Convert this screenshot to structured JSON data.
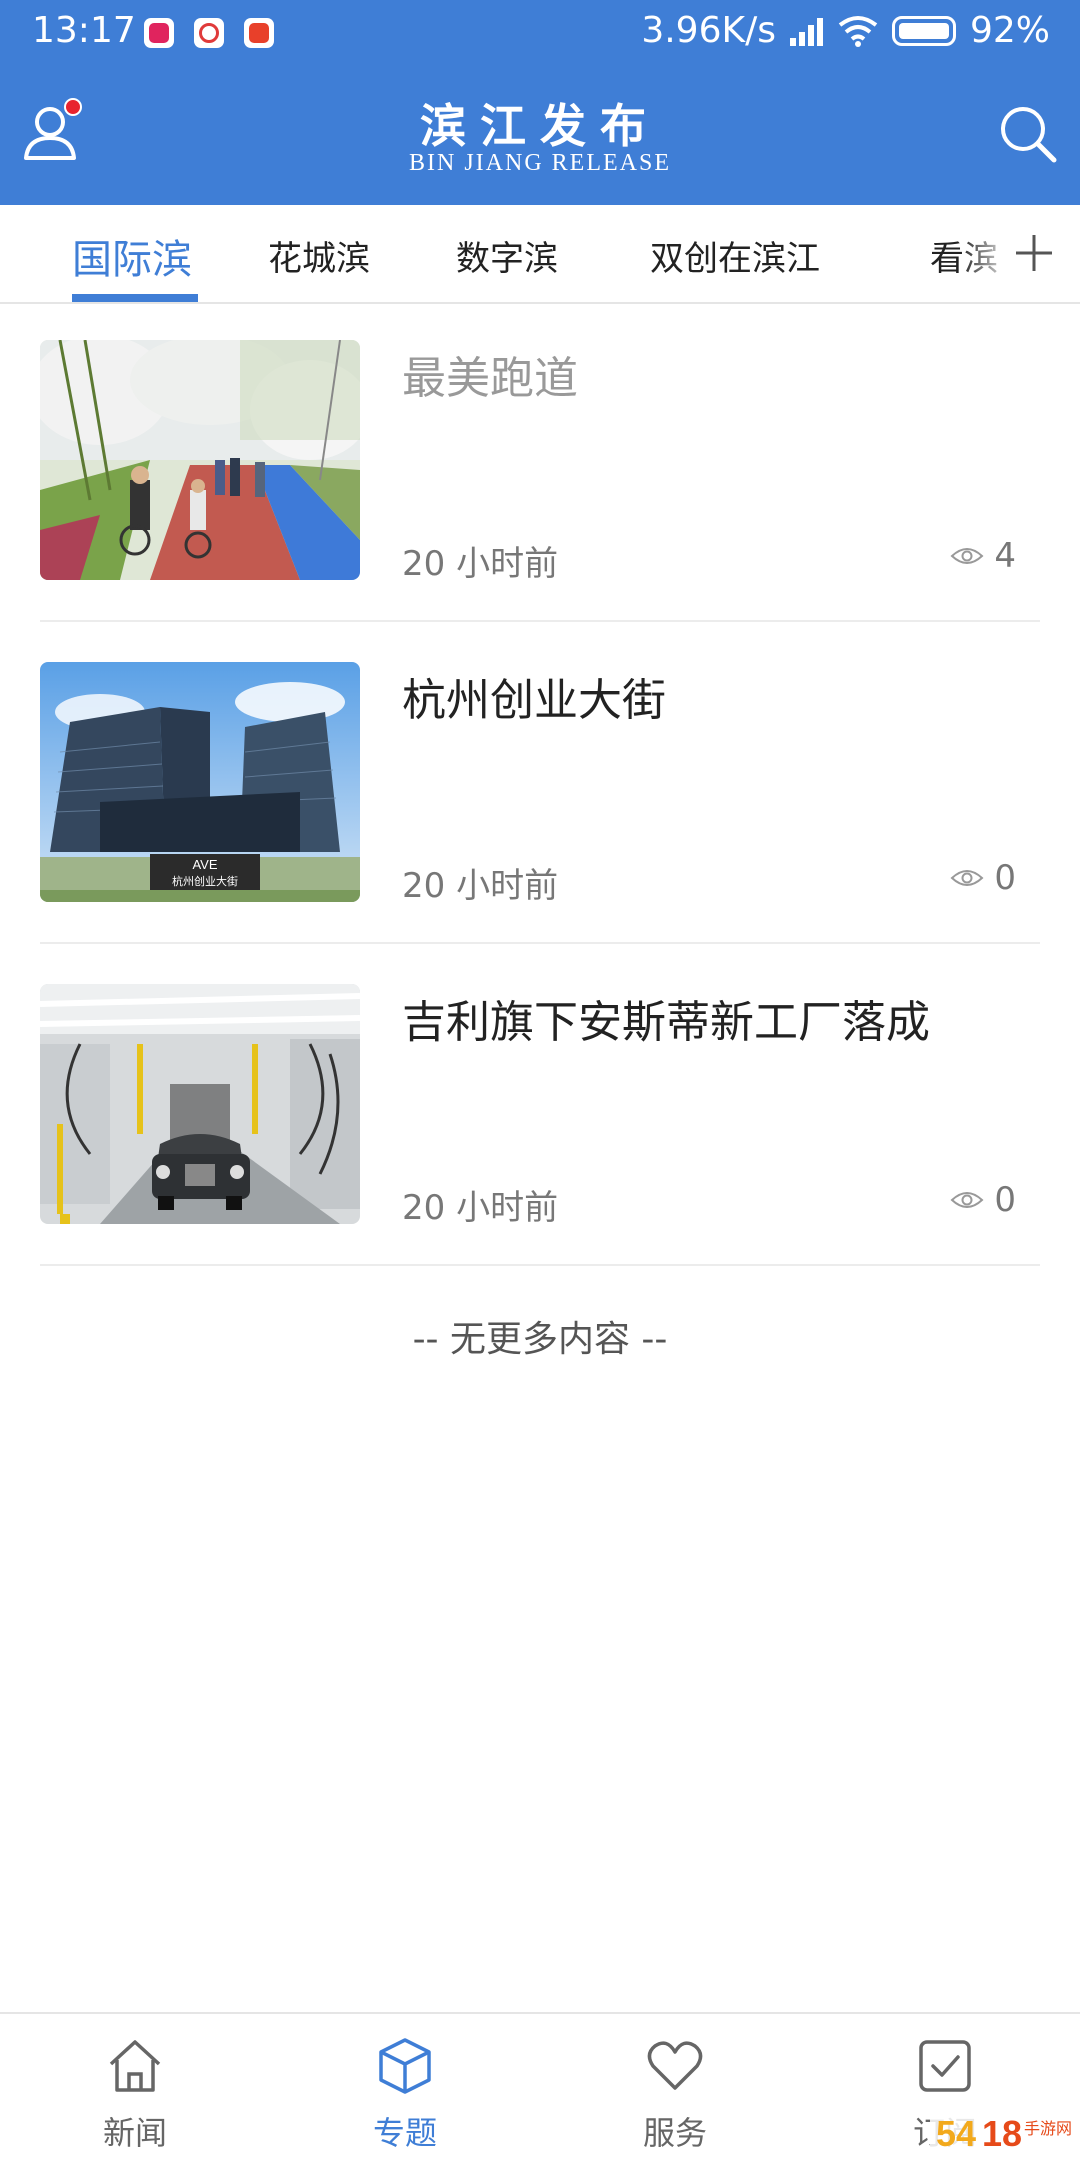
{
  "status_bar": {
    "time": "13:17",
    "network_speed": "3.96K/s",
    "battery": "92%"
  },
  "header": {
    "title": "滨江发布",
    "subtitle": "BIN JIANG RELEASE",
    "accent_color": "#3f7ed6"
  },
  "tabs": [
    {
      "label": "国际滨",
      "active": true
    },
    {
      "label": "花城滨",
      "active": false
    },
    {
      "label": "数字滨",
      "active": false
    },
    {
      "label": "双创在滨江",
      "active": false
    },
    {
      "label": "看滨",
      "active": false
    }
  ],
  "news": [
    {
      "title": "最美跑道",
      "time": "20 小时前",
      "views": "4",
      "read": true,
      "thumb": "running-track-photo"
    },
    {
      "title": "杭州创业大街",
      "time": "20 小时前",
      "views": "0",
      "read": false,
      "thumb": "office-building-photo",
      "thumb_sign": "杭州创业大街",
      "thumb_logo": "AVE"
    },
    {
      "title": "吉利旗下安斯蒂新工厂落成",
      "time": "20 小时前",
      "views": "0",
      "read": false,
      "thumb": "car-factory-photo"
    }
  ],
  "no_more": "-- 无更多内容 --",
  "bottom_nav": [
    {
      "label": "新闻",
      "icon": "home-icon",
      "active": false
    },
    {
      "label": "专题",
      "icon": "cube-icon",
      "active": true
    },
    {
      "label": "服务",
      "icon": "heart-icon",
      "active": false
    },
    {
      "label": "订阅",
      "icon": "checkbox-icon",
      "active": false
    }
  ],
  "watermark": "5418手游网"
}
